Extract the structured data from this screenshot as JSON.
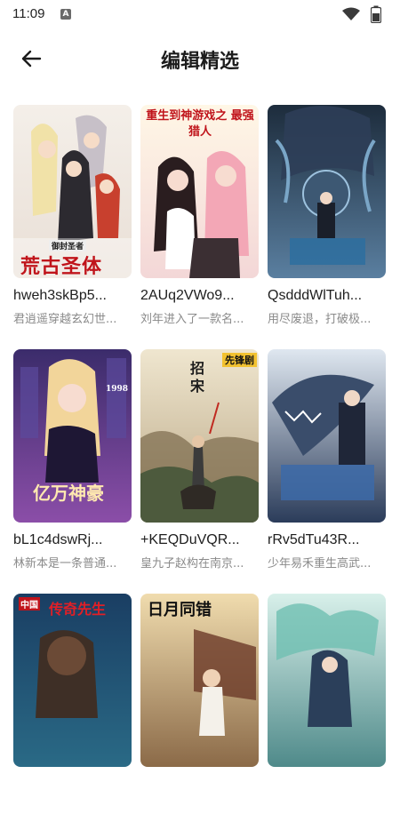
{
  "status_bar": {
    "time": "11:09",
    "notification_glyph": "A"
  },
  "header": {
    "title": "编辑精选",
    "back_icon": "arrow-left-icon"
  },
  "comics": [
    {
      "title": "hweh3skBp5...",
      "desc": "君逍遥穿越玄幻世...",
      "cover_text": "荒古圣体",
      "cover_sub": "御封圣者"
    },
    {
      "title": "2AUq2VWo9...",
      "desc": "刘年进入了一款名...",
      "cover_text": "重生到神游戏之 最强猎人",
      "cover_sub": ""
    },
    {
      "title": "QsdddWlTuh...",
      "desc": "用尽废退，打破极...",
      "cover_text": "",
      "cover_sub": ""
    },
    {
      "title": "bL1c4dswRj...",
      "desc": "林新本是一条普通...",
      "cover_text": "亿万神豪",
      "cover_sub": "1998"
    },
    {
      "title": "+KEQDuVQR...",
      "desc": "皇九子赵构在南京...",
      "cover_text": "招宋",
      "cover_sub": "先锋剧"
    },
    {
      "title": "rRv5dTu43R...",
      "desc": "少年易禾重生高武...",
      "cover_text": "",
      "cover_sub": ""
    },
    {
      "title": "",
      "desc": "",
      "cover_text": "传奇先生",
      "cover_sub": "中国"
    },
    {
      "title": "",
      "desc": "",
      "cover_text": "日月同错",
      "cover_sub": ""
    },
    {
      "title": "",
      "desc": "",
      "cover_text": "",
      "cover_sub": ""
    }
  ]
}
